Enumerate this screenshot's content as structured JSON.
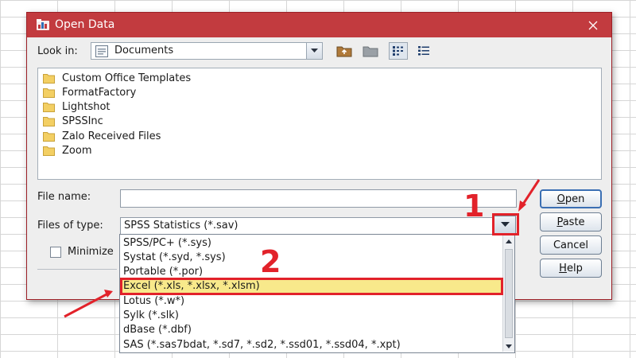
{
  "window": {
    "title": "Open Data"
  },
  "toolbar": {
    "look_in_label": "Look in:",
    "look_in_value": "Documents"
  },
  "files": [
    "Custom Office Templates",
    "FormatFactory",
    "Lightshot",
    "SPSSInc",
    "Zalo Received Files",
    "Zoom"
  ],
  "form": {
    "file_name_label": "File name:",
    "file_name_value": "",
    "files_of_type_label": "Files of type:",
    "files_of_type_value": "SPSS Statistics (*.sav)",
    "minimize_label": "Minimize"
  },
  "buttons": {
    "open": {
      "accel": "O",
      "rest": "pen"
    },
    "paste": {
      "accel": "P",
      "rest": "aste"
    },
    "cancel": "Cancel",
    "help": {
      "accel": "H",
      "rest": "elp"
    }
  },
  "type_options": [
    "SPSS/PC+ (*.sys)",
    "Systat (*.syd, *.sys)",
    "Portable (*.por)",
    "Excel (*.xls, *.xlsx, *.xlsm)",
    "Lotus (*.w*)",
    "Sylk (*.slk)",
    "dBase (*.dbf)",
    "SAS (*.sas7bdat, *.sd7, *.sd2, *.ssd01, *.ssd04, *.xpt)"
  ],
  "selected_type_index": 3,
  "annotations": {
    "label_1": "1",
    "label_2": "2"
  },
  "colors": {
    "titlebar": "#c23b3f",
    "highlight": "#f8e98b",
    "annotation": "#e2222a",
    "folder": "#f3cf63"
  }
}
